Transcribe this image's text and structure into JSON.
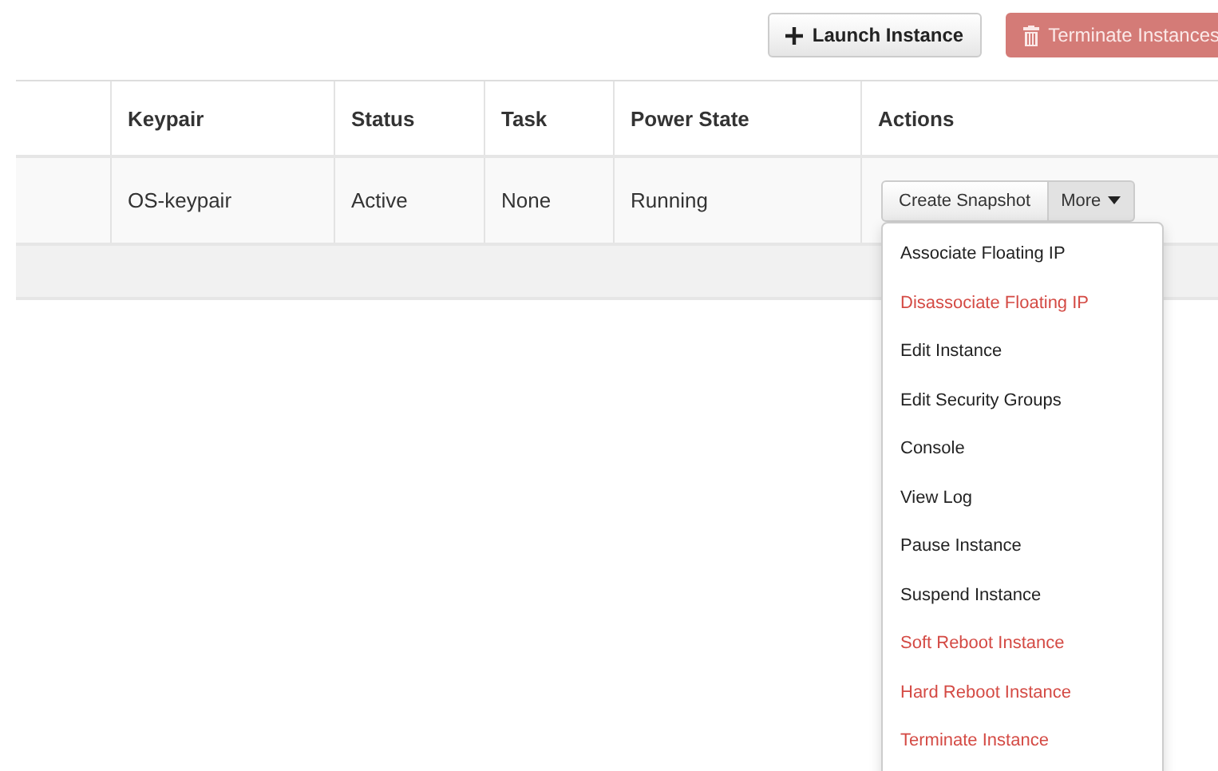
{
  "toolbar": {
    "buttons": [
      {
        "label": "Launch Instance",
        "kind": "default"
      },
      {
        "label": "Terminate Instances",
        "kind": "danger"
      }
    ]
  },
  "table": {
    "columns": [
      "Keypair",
      "Status",
      "Task",
      "Power State",
      "Actions"
    ],
    "rows": [
      {
        "cells": [
          "OS-keypair",
          "Active",
          "None",
          "Running"
        ],
        "actions": {
          "primary": "Create Snapshot",
          "more": "More",
          "expanded": true
        }
      }
    ]
  },
  "menu": {
    "items": [
      {
        "label": "Associate Floating IP",
        "kind": "normal"
      },
      {
        "label": "Disassociate Floating IP",
        "kind": "danger"
      },
      {
        "label": "Edit Instance",
        "kind": "normal"
      },
      {
        "label": "Edit Security Groups",
        "kind": "normal"
      },
      {
        "label": "Console",
        "kind": "normal"
      },
      {
        "label": "View Log",
        "kind": "normal"
      },
      {
        "label": "Pause Instance",
        "kind": "normal"
      },
      {
        "label": "Suspend Instance",
        "kind": "normal"
      },
      {
        "label": "Soft Reboot Instance",
        "kind": "danger"
      },
      {
        "label": "Hard Reboot Instance",
        "kind": "danger"
      },
      {
        "label": "Terminate Instance",
        "kind": "danger"
      }
    ]
  }
}
